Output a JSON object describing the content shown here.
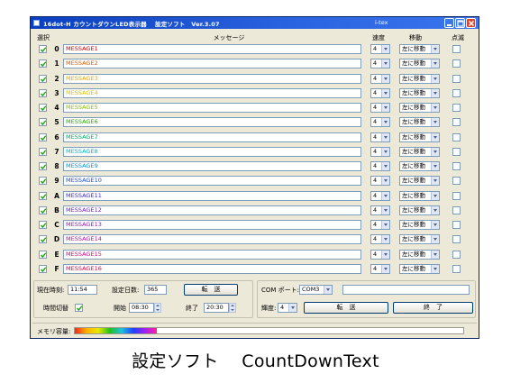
{
  "window": {
    "title": "16dot-H カウントダウンLED表示器　 設定ソフト　Ver.3.07",
    "company": "i-tex"
  },
  "headers": {
    "select": "選択",
    "message": "メッセージ",
    "speed": "速度",
    "move": "移動",
    "blink": "点滅"
  },
  "rows": [
    {
      "index": "0",
      "message": "MESSAGE1",
      "color": "#cc0000",
      "speed": "4",
      "move": "左に移動",
      "selected": true,
      "blink": false
    },
    {
      "index": "1",
      "message": "MESSAGE2",
      "color": "#e05a00",
      "speed": "4",
      "move": "左に移動",
      "selected": true,
      "blink": false
    },
    {
      "index": "2",
      "message": "MESSAGE3",
      "color": "#e0a800",
      "speed": "4",
      "move": "左に移動",
      "selected": true,
      "blink": false
    },
    {
      "index": "3",
      "message": "MESSAGE4",
      "color": "#d8c000",
      "speed": "4",
      "move": "左に移動",
      "selected": true,
      "blink": false
    },
    {
      "index": "4",
      "message": "MESSAGE5",
      "color": "#8cbc00",
      "speed": "4",
      "move": "左に移動",
      "selected": true,
      "blink": false
    },
    {
      "index": "5",
      "message": "MESSAGE6",
      "color": "#2aa800",
      "speed": "4",
      "move": "左に移動",
      "selected": true,
      "blink": false
    },
    {
      "index": "6",
      "message": "MESSAGE7",
      "color": "#00a860",
      "speed": "4",
      "move": "左に移動",
      "selected": true,
      "blink": false
    },
    {
      "index": "7",
      "message": "MESSAGE8",
      "color": "#00b4c0",
      "speed": "4",
      "move": "左に移動",
      "selected": true,
      "blink": false
    },
    {
      "index": "8",
      "message": "MESSAGE9",
      "color": "#0090d8",
      "speed": "4",
      "move": "左に移動",
      "selected": true,
      "blink": false
    },
    {
      "index": "9",
      "message": "MESSAGE10",
      "color": "#1a4ad8",
      "speed": "4",
      "move": "左に移動",
      "selected": true,
      "blink": false
    },
    {
      "index": "A",
      "message": "MESSAGE11",
      "color": "#3b2ad0",
      "speed": "4",
      "move": "左に移動",
      "selected": true,
      "blink": false
    },
    {
      "index": "B",
      "message": "MESSAGE12",
      "color": "#6a20c8",
      "speed": "4",
      "move": "左に移動",
      "selected": true,
      "blink": false
    },
    {
      "index": "C",
      "message": "MESSAGE13",
      "color": "#9018b8",
      "speed": "4",
      "move": "左に移動",
      "selected": true,
      "blink": false
    },
    {
      "index": "D",
      "message": "MESSAGE14",
      "color": "#b8109c",
      "speed": "4",
      "move": "左に移動",
      "selected": true,
      "blink": false
    },
    {
      "index": "E",
      "message": "MESSAGE15",
      "color": "#cc0878",
      "speed": "4",
      "move": "左に移動",
      "selected": true,
      "blink": false
    },
    {
      "index": "F",
      "message": "MESSAGE16",
      "color": "#d0044c",
      "speed": "4",
      "move": "左に移動",
      "selected": true,
      "blink": false
    }
  ],
  "bottom": {
    "current_time_label": "現在時刻:",
    "current_time": "11:54",
    "days_label": "設定日数:",
    "days": "365",
    "transfer_label": "転　送",
    "time_switch_label": "時間切替",
    "time_switch_checked": true,
    "start_label": "開始",
    "start_time": "08:30",
    "end_label": "終了",
    "end_time": "20:30",
    "com_label": "COM ポート:",
    "com_value": "COM3",
    "brightness_label": "輝度:",
    "brightness_value": "4",
    "transfer2_label": "転　送",
    "exit_label": "終　了"
  },
  "status": {
    "memory_label": "メモリ容量:",
    "memory_used_fraction": 0.21
  },
  "caption": "設定ソフト　 CountDownText"
}
